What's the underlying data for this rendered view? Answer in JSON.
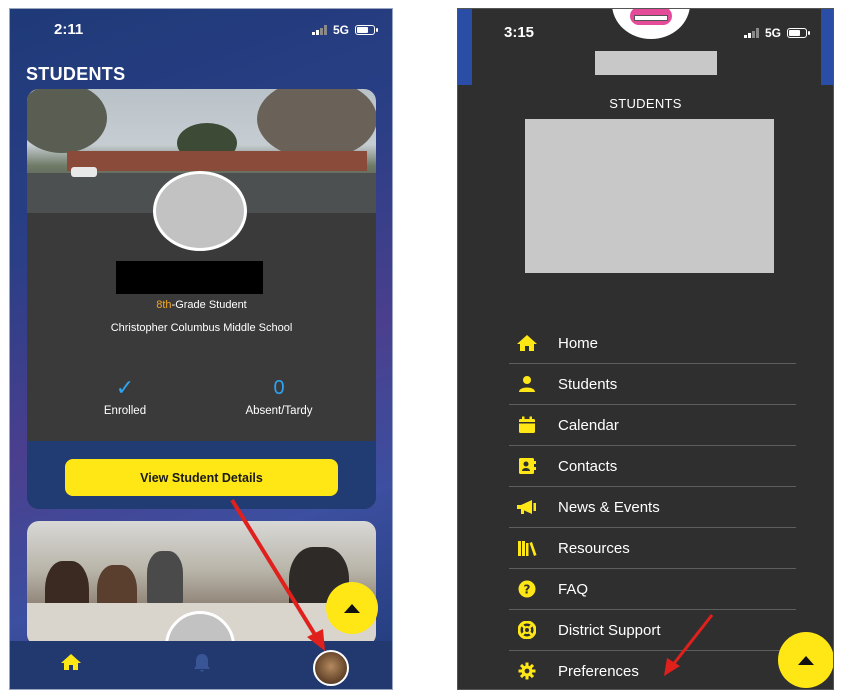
{
  "left_screen": {
    "status": {
      "time": "2:11",
      "network": "5G"
    },
    "page_title": "STUDENTS",
    "student_card": {
      "grade_accent": "8th",
      "grade_rest": "-Grade Student",
      "school": "Christopher Columbus Middle School",
      "stats": [
        {
          "icon": "checkmark-icon",
          "value": "✓",
          "label": "Enrolled"
        },
        {
          "icon": "",
          "value": "0",
          "label": "Absent/Tardy"
        }
      ],
      "details_button": "View Student Details"
    },
    "bottom_nav": {
      "items": [
        "home-icon",
        "bell-icon",
        "profile-avatar"
      ]
    }
  },
  "right_screen": {
    "status": {
      "time": "3:15",
      "network": "5G"
    },
    "drawer_title": "STUDENTS",
    "menu": [
      {
        "label": "Home",
        "icon": "home-icon"
      },
      {
        "label": "Students",
        "icon": "person-icon"
      },
      {
        "label": "Calendar",
        "icon": "calendar-icon"
      },
      {
        "label": "Contacts",
        "icon": "contact-card-icon"
      },
      {
        "label": "News & Events",
        "icon": "megaphone-icon"
      },
      {
        "label": "Resources",
        "icon": "books-icon"
      },
      {
        "label": "FAQ",
        "icon": "question-icon"
      },
      {
        "label": "District Support",
        "icon": "lifebuoy-icon"
      },
      {
        "label": "Preferences",
        "icon": "gear-icon"
      }
    ]
  },
  "colors": {
    "accent_yellow": "#ffe716",
    "accent_orange": "#f5a623",
    "accent_blue": "#2ea3f2",
    "nav_blue": "#22396f",
    "annotation_red": "#e0201c"
  }
}
